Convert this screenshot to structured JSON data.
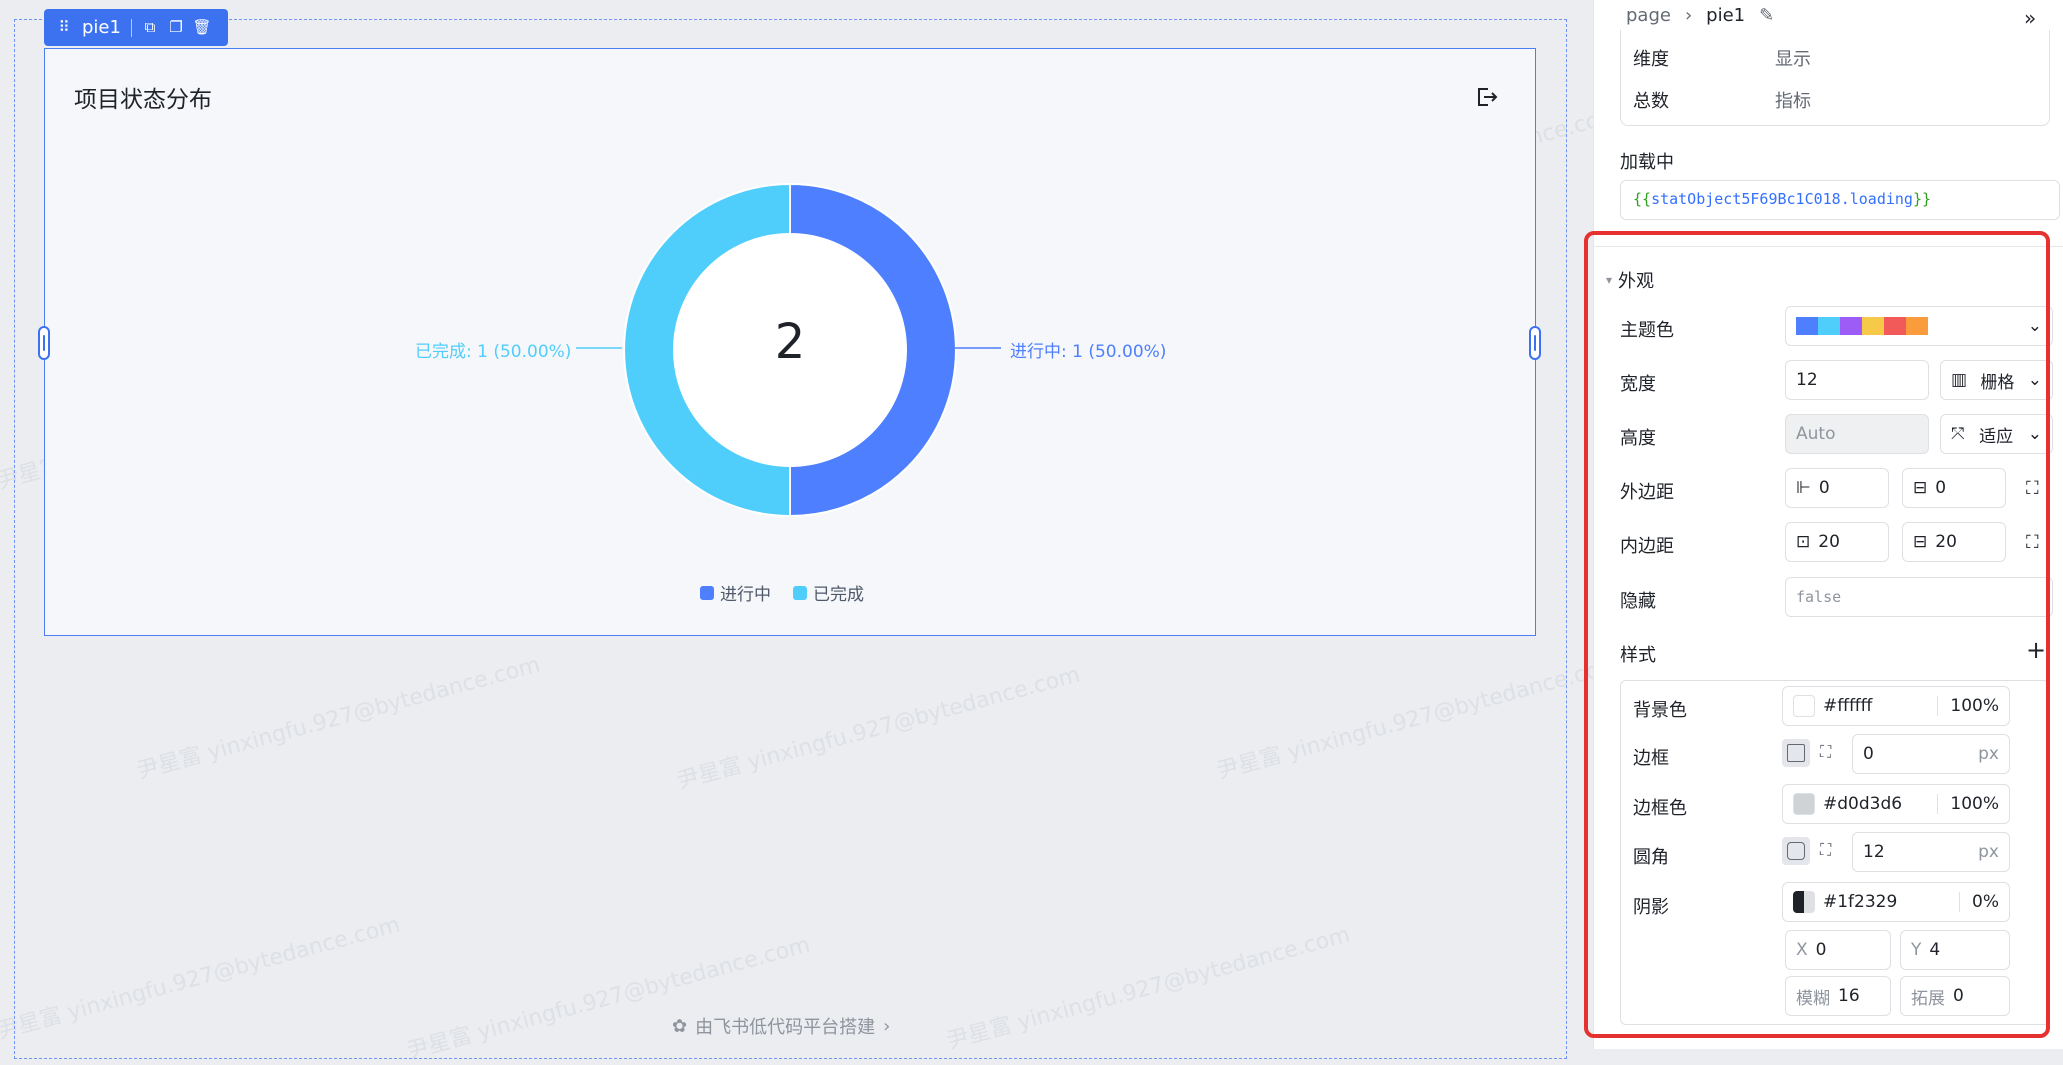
{
  "editor": {
    "selection_chip": {
      "label": "pie1"
    },
    "watermark": "尹星富 yinxingfu.927@bytedance.com",
    "footer": {
      "text": "由飞书低代码平台搭建"
    }
  },
  "card": {
    "title": "项目状态分布"
  },
  "chart_data": {
    "type": "pie",
    "donut": true,
    "title": "项目状态分布",
    "center_value": "2",
    "slices": [
      {
        "name": "进行中",
        "value": 1,
        "percent": "50.00%",
        "color": "#4d7ffe",
        "label": "进行中: 1 (50.00%)"
      },
      {
        "name": "已完成",
        "value": 1,
        "percent": "50.00%",
        "color": "#50cefb",
        "label": "已完成: 1 (50.00%)"
      }
    ],
    "legend": [
      "进行中",
      "已完成"
    ],
    "legend_position": "bottom"
  },
  "panel": {
    "breadcrumb": {
      "root": "page",
      "current": "pie1"
    },
    "data_fields": [
      {
        "key": "维度",
        "value": "显示"
      },
      {
        "key": "总数",
        "value": "指标"
      }
    ],
    "loading": {
      "label": "加载中",
      "open": "{{",
      "expr": "statObject5F69Bc1C018.loading",
      "close": "}}"
    },
    "appearance": {
      "section_title": "外观",
      "theme_color": {
        "label": "主题色",
        "palette": [
          "#4d7ffe",
          "#50cefb",
          "#9c5cf5",
          "#f7c948",
          "#f25a5a",
          "#fa9b3c"
        ]
      },
      "width": {
        "label": "宽度",
        "value": "12",
        "mode": "栅格"
      },
      "height": {
        "label": "高度",
        "placeholder": "Auto",
        "mode": "适应"
      },
      "margin": {
        "label": "外边距",
        "h": "0",
        "v": "0"
      },
      "padding": {
        "label": "内边距",
        "h": "20",
        "v": "20"
      },
      "hidden": {
        "label": "隐藏",
        "value": "false"
      }
    },
    "style": {
      "section_title": "样式",
      "add_label": "+",
      "bg": {
        "label": "背景色",
        "hex": "#ffffff",
        "opacity": "100%",
        "color": "#ffffff"
      },
      "border": {
        "label": "边框",
        "value": "0",
        "unit": "px"
      },
      "border_color": {
        "label": "边框色",
        "hex": "#d0d3d6",
        "opacity": "100%",
        "color": "#d0d3d6"
      },
      "radius": {
        "label": "圆角",
        "value": "12",
        "unit": "px"
      },
      "shadow": {
        "label": "阴影",
        "hex": "#1f2329",
        "opacity": "0%",
        "x_label": "X",
        "x": "0",
        "y_label": "Y",
        "y": "4",
        "blur_label": "模糊",
        "blur": "16",
        "spread_label": "拓展",
        "spread": "0"
      }
    }
  }
}
